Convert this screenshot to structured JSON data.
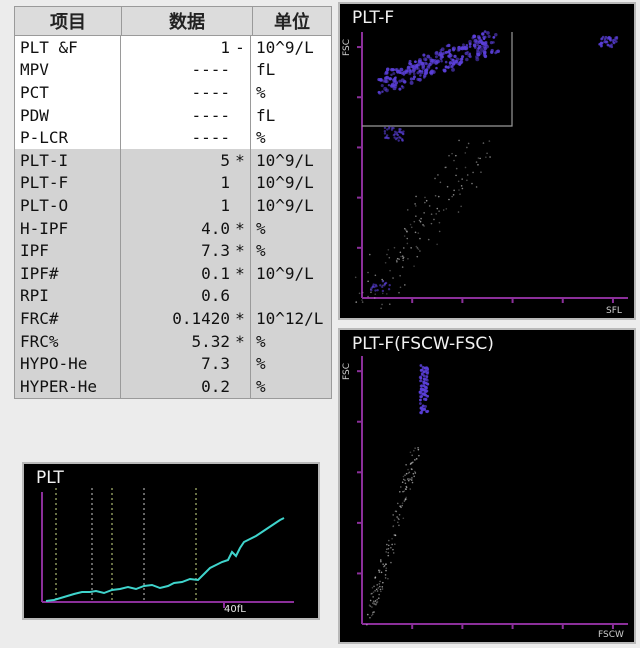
{
  "table": {
    "headers": {
      "item": "项目",
      "value": "数据",
      "unit": "单位"
    },
    "rows": [
      {
        "name": "PLT &F",
        "value": "1",
        "flag": "-",
        "unit": "10^9/L",
        "shade": false
      },
      {
        "name": "MPV",
        "value": "----",
        "flag": "",
        "unit": "fL",
        "shade": false
      },
      {
        "name": "PCT",
        "value": "----",
        "flag": "",
        "unit": "%",
        "shade": false
      },
      {
        "name": "PDW",
        "value": "----",
        "flag": "",
        "unit": "fL",
        "shade": false
      },
      {
        "name": "P-LCR",
        "value": "----",
        "flag": "",
        "unit": "%",
        "shade": false
      },
      {
        "name": "PLT-I",
        "value": "5",
        "flag": "*",
        "unit": "10^9/L",
        "shade": true
      },
      {
        "name": "PLT-F",
        "value": "1",
        "flag": "",
        "unit": "10^9/L",
        "shade": true
      },
      {
        "name": "PLT-O",
        "value": "1",
        "flag": "",
        "unit": "10^9/L",
        "shade": true
      },
      {
        "name": "H-IPF",
        "value": "4.0",
        "flag": "*",
        "unit": "%",
        "shade": true
      },
      {
        "name": "IPF",
        "value": "7.3",
        "flag": "*",
        "unit": "%",
        "shade": true
      },
      {
        "name": "IPF#",
        "value": "0.1",
        "flag": "*",
        "unit": "10^9/L",
        "shade": true
      },
      {
        "name": "RPI",
        "value": "0.6",
        "flag": "",
        "unit": "",
        "shade": true
      },
      {
        "name": "FRC#",
        "value": "0.1420",
        "flag": "*",
        "unit": "10^12/L",
        "shade": true
      },
      {
        "name": "FRC%",
        "value": "5.32",
        "flag": "*",
        "unit": "%",
        "shade": true
      },
      {
        "name": "HYPO-He",
        "value": "7.3",
        "flag": "",
        "unit": "%",
        "shade": true
      },
      {
        "name": "HYPER-He",
        "value": "0.2",
        "flag": "",
        "unit": "%",
        "shade": true
      }
    ]
  },
  "histogram": {
    "title": "PLT",
    "x_marker_label": "40fL",
    "colors": {
      "curve": "#3fd4cc",
      "axis": "#8b2f9a",
      "guide": "#cfe08a"
    }
  },
  "scatter_plt_f": {
    "title": "PLT-F",
    "x_label": "SFL",
    "y_label": "FSC",
    "colors": {
      "axis": "#8b2f9a",
      "gate": "#9a9a9a",
      "cluster": "#5a3fd8"
    }
  },
  "scatter_fscw": {
    "title": "PLT-F(FSCW-FSC)",
    "x_label": "FSCW",
    "y_label": "FSC",
    "colors": {
      "axis": "#8b2f9a",
      "cluster": "#5a3fd8"
    }
  }
}
